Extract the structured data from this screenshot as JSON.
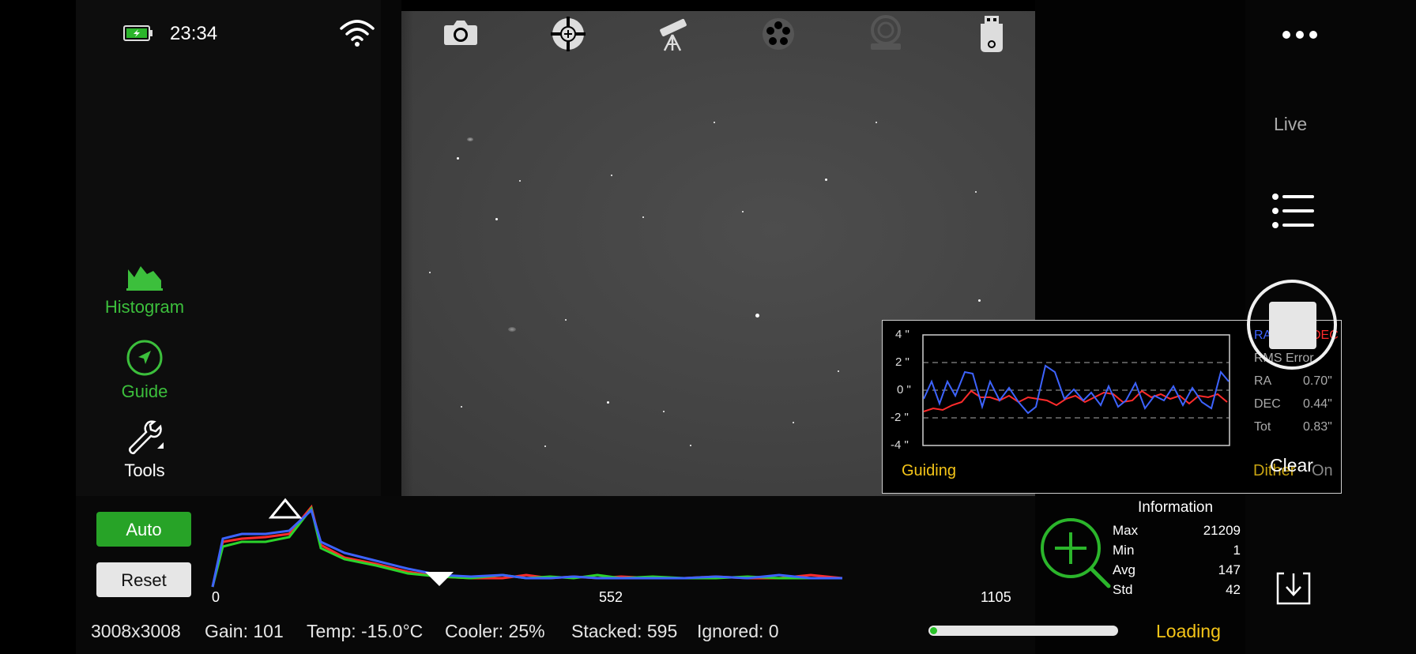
{
  "status_bar": {
    "time": "23:34"
  },
  "top_toolbar": {
    "icons": [
      "camera-icon",
      "focuser-icon",
      "telescope-icon",
      "filter-wheel-icon",
      "rotator-icon",
      "usb-drive-icon"
    ]
  },
  "left_sidebar": {
    "histogram_label": "Histogram",
    "guide_label": "Guide",
    "tools_label": "Tools"
  },
  "histogram": {
    "auto_label": "Auto",
    "reset_label": "Reset",
    "tick_min": "0",
    "tick_mid": "552",
    "tick_max": "1105"
  },
  "status_line": {
    "resolution": "3008x3008",
    "gain": "Gain: 101",
    "temp": "Temp: -15.0°C",
    "cooler": "Cooler: 25%",
    "stacked": "Stacked: 595",
    "ignored": "Ignored: 0",
    "progress_fraction": 0.03,
    "loading": "Loading"
  },
  "guide_graph": {
    "y_labels": [
      "4 \"",
      "2 \"",
      "0 \"",
      "-2 \"",
      "-4 \""
    ],
    "legend_ra": "RA",
    "legend_dec": "DEC",
    "rms_title": "RMS Error",
    "rms_ra_label": "RA",
    "rms_ra_value": "0.70\"",
    "rms_dec_label": "DEC",
    "rms_dec_value": "0.44\"",
    "rms_tot_label": "Tot",
    "rms_tot_value": "0.83\"",
    "guiding_label": "Guiding",
    "dither_label": "Dither",
    "dither_state": "On",
    "clear_label": "Clear",
    "colors": {
      "ra": "#3d63ff",
      "dec": "#ff2b2b"
    }
  },
  "information": {
    "title": "Information",
    "rows": [
      {
        "label": "Max",
        "value": "21209"
      },
      {
        "label": "Min",
        "value": "1"
      },
      {
        "label": "Avg",
        "value": "147"
      },
      {
        "label": "Std",
        "value": "42"
      }
    ]
  },
  "right_panel": {
    "live_label": "Live"
  }
}
